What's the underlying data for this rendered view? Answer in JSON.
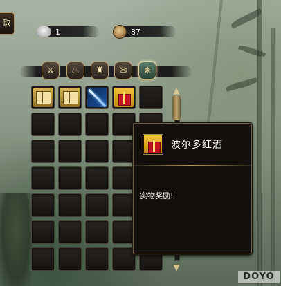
{
  "top_button": {
    "label": "取"
  },
  "currency": [
    {
      "icon": "silver-ingot-icon",
      "value": "1"
    },
    {
      "icon": "copper-coin-icon",
      "value": "87"
    }
  ],
  "tabs": [
    {
      "icon": "sword-icon",
      "glyph": "⚔"
    },
    {
      "icon": "potion-icon",
      "glyph": "♨"
    },
    {
      "icon": "armor-icon",
      "glyph": "♜"
    },
    {
      "icon": "scroll-icon",
      "glyph": "✉"
    },
    {
      "icon": "misc-icon",
      "glyph": "❋"
    }
  ],
  "inventory": {
    "columns": 5,
    "rows": 7,
    "items": [
      {
        "slot": 0,
        "type": "book",
        "icon": "skill-book-icon"
      },
      {
        "slot": 1,
        "type": "book",
        "icon": "skill-book-icon"
      },
      {
        "slot": 2,
        "type": "sword",
        "icon": "blue-sword-icon"
      },
      {
        "slot": 3,
        "type": "gift",
        "icon": "gift-box-icon"
      }
    ]
  },
  "tooltip": {
    "item_name": "波尔多红酒",
    "description": "实物奖励!",
    "icon": "gift-box-icon"
  },
  "watermark": "DOYO"
}
